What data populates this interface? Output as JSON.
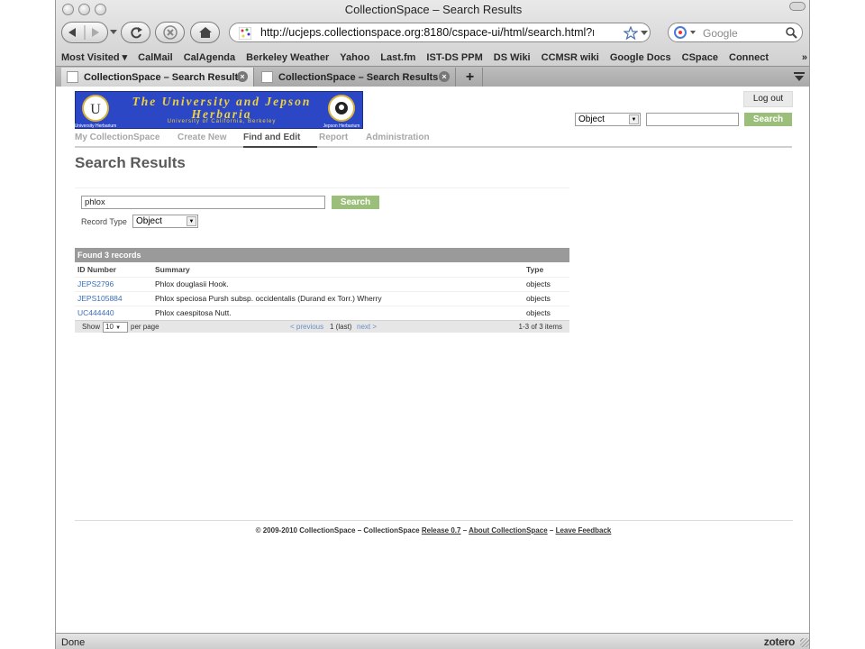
{
  "window": {
    "title": "CollectionSpace – Search Results"
  },
  "toolbar": {
    "url": "http://ucjeps.collectionspace.org:8180/cspace-ui/html/search.html?recordty",
    "search_placeholder": "Google"
  },
  "bookmarks": [
    "Most Visited ▾",
    "CalMail",
    "CalAgenda",
    "Berkeley Weather",
    "Yahoo",
    "Last.fm",
    "IST-DS PPM",
    "DS Wiki",
    "CCMSR wiki",
    "Google Docs",
    "CSpace",
    "Connect"
  ],
  "bookmarks_overflow": "»",
  "tabs": [
    {
      "label": "CollectionSpace – Search Results"
    },
    {
      "label": "CollectionSpace – Search Results"
    }
  ],
  "new_tab": "+",
  "header": {
    "banner_title_line1": "The University and Jepson",
    "banner_title_line2": "Herbaria",
    "banner_subtitle": "University of California, Berkeley",
    "left_seal_label": "University Herbarium",
    "right_seal_label": "Jepson Herbarium",
    "logout": "Log out",
    "type_select": "Object",
    "search_button": "Search"
  },
  "nav": [
    {
      "label": "My CollectionSpace",
      "active": false
    },
    {
      "label": "Create New",
      "active": false
    },
    {
      "label": "Find and Edit",
      "active": true
    },
    {
      "label": "Report",
      "active": false
    },
    {
      "label": "Administration",
      "active": false
    }
  ],
  "main": {
    "title": "Search Results",
    "query": "phlox",
    "search_button": "Search",
    "record_type_label": "Record Type",
    "record_type_value": "Object"
  },
  "results": {
    "heading": "Found 3 records",
    "columns": [
      "ID Number",
      "Summary",
      "Type"
    ],
    "rows": [
      {
        "id": "JEPS2796",
        "summary": "Phlox douglasii Hook.",
        "type": "objects"
      },
      {
        "id": "JEPS105884",
        "summary": "Phlox speciosa Pursh subsp. occidentalis (Durand ex Torr.) Wherry",
        "type": "objects"
      },
      {
        "id": "UC444440",
        "summary": "Phlox caespitosa Nutt.",
        "type": "objects"
      }
    ],
    "pager": {
      "show": "Show",
      "page_size": "10",
      "per_page": "per page",
      "previous": "< previous",
      "current": "1 (last)",
      "next": "next >",
      "items": "1-3 of 3 items"
    }
  },
  "footer": {
    "copyright": "© 2009-2010 CollectionSpace",
    "dash": "–",
    "release_prefix": "CollectionSpace",
    "release_link": "Release 0.7",
    "about": "About CollectionSpace",
    "feedback": "Leave Feedback"
  },
  "status": {
    "text": "Done",
    "zotero": "zotero"
  }
}
